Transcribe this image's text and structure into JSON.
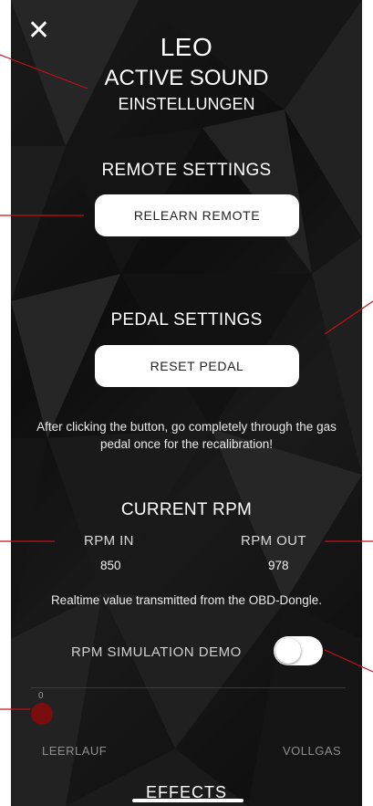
{
  "header": {
    "close_glyph": "✕",
    "title": "LEO",
    "subtitle": "ACTIVE SOUND",
    "caption": "EINSTELLUNGEN"
  },
  "remote": {
    "title": "REMOTE SETTINGS",
    "button_label": "RELEARN REMOTE"
  },
  "pedal": {
    "title": "PEDAL SETTINGS",
    "button_label": "RESET PEDAL",
    "hint": "After clicking the button, go completely through the gas pedal once for the recalibration!"
  },
  "rpm": {
    "title": "CURRENT RPM",
    "in_label": "RPM IN",
    "in_value": "850",
    "out_label": "RPM OUT",
    "out_value": "978",
    "note": "Realtime value transmitted from the OBD-Dongle."
  },
  "simulation": {
    "label": "RPM SIMULATION DEMO",
    "enabled": false
  },
  "throttle_slider": {
    "value_label": "0",
    "min_label": "LEERLAUF",
    "max_label": "VOLLGAS"
  },
  "bottom_tab": {
    "label": "EFFECTS"
  },
  "colors": {
    "background": "#111111",
    "button": "#ffffff",
    "slider_thumb": "#7a0d0d",
    "annotation_line": "#c0101a"
  }
}
